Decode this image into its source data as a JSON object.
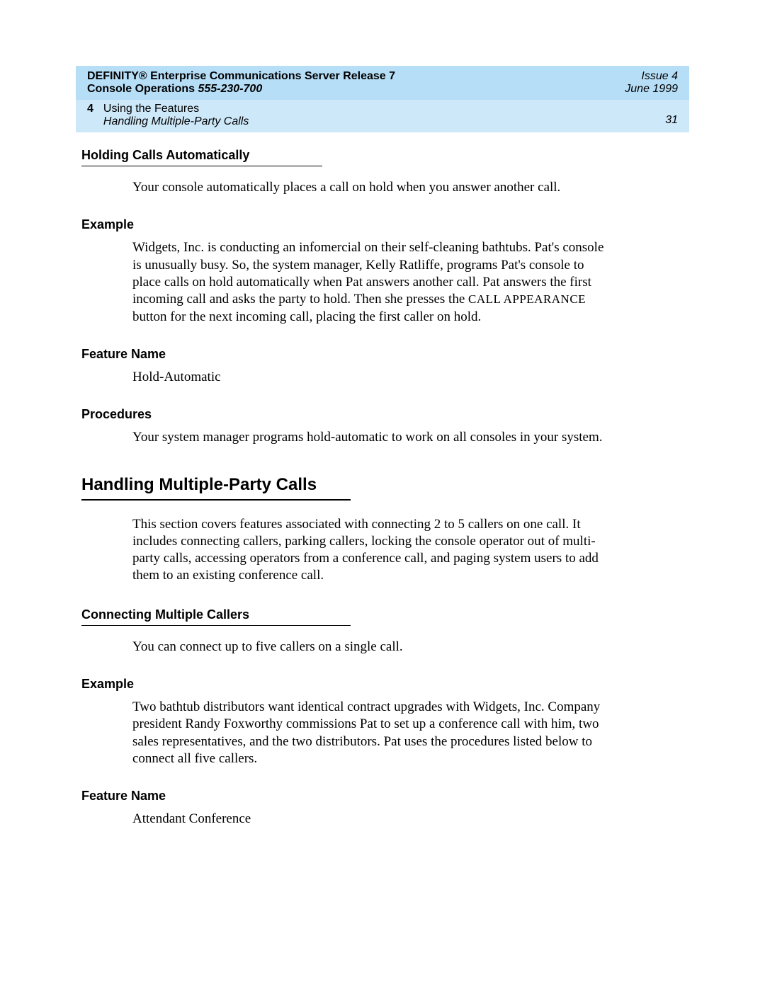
{
  "header": {
    "title_line1": "DEFINITY® Enterprise Communications Server Release 7",
    "title_line2_prefix": "Console Operations  ",
    "doc_number": "555-230-700",
    "issue": "Issue 4",
    "date": "June 1999",
    "chapter_number": "4",
    "chapter_title": "Using the Features",
    "chapter_subtitle": "Handling Multiple-Party Calls",
    "page_number": "31"
  },
  "sec1": {
    "heading": "Holding Calls Automatically",
    "intro": "Your console automatically places a call on hold when you answer another call.",
    "example_label": "Example",
    "example_body_before": "Widgets, Inc. is conducting an infomercial on their self-cleaning bathtubs. Pat's console is unusually busy. So, the system manager, Kelly Ratliffe, programs Pat's console to place calls on hold automatically when Pat answers another call. Pat answers the first incoming call and asks the party to hold. Then she presses the ",
    "example_smallcaps": "CALL APPEARANCE",
    "example_body_after": " button for the next incoming call, placing the first caller on hold.",
    "feature_label": "Feature Name",
    "feature_value": "Hold-Automatic",
    "procedures_label": "Procedures",
    "procedures_body": "Your system manager programs hold-automatic to work on all consoles in your system."
  },
  "sec2": {
    "heading": "Handling Multiple-Party Calls",
    "intro": "This section covers features associated with connecting 2 to 5 callers on one call. It includes connecting callers, parking callers, locking the console operator out of multi-party calls, accessing operators from a conference call, and paging system users to add them to an existing conference call.",
    "sub_heading": "Connecting Multiple Callers",
    "sub_intro": "You can connect up to five callers on a single call.",
    "example_label": "Example",
    "example_body": "Two bathtub distributors want identical contract upgrades with Widgets, Inc. Company president Randy Foxworthy commissions Pat to set up a conference call with him, two sales representatives, and the two distributors. Pat uses the procedures listed below to connect all five callers.",
    "feature_label": "Feature Name",
    "feature_value": "Attendant Conference"
  }
}
